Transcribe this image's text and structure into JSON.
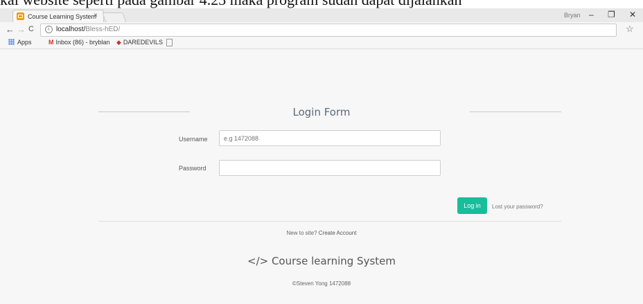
{
  "doc_caption": "kai website seperti pada gambar 4.23 maka program sudah dapat dijalankan",
  "browser": {
    "tab_title": "Course Learning System",
    "tab_close": "×",
    "user_label": "Bryan",
    "win_minimize": "–",
    "win_restore": "❐",
    "win_close": "✕",
    "back": "←",
    "forward": "→",
    "reload": "C",
    "url_host": "localhost/",
    "url_path": "Bless-hED/",
    "star": "☆",
    "bookmarks": {
      "apps": "Apps",
      "gmail": "Inbox (86) - bryblan",
      "daredevils": "DAREDEVILS"
    }
  },
  "page": {
    "form_title": "Login Form",
    "username_label": "Username",
    "username_placeholder": "e.g 1472088",
    "password_label": "Password",
    "login_button": "Log in",
    "lost_password": "Lost your password?",
    "new_to_site": "New to site? ",
    "create_account": "Create Account",
    "brand": "</> Course learning System",
    "copyright": "©Steven Yong 1472088"
  },
  "colors": {
    "accent": "#1abc9c",
    "page_bg": "#f7f7f7"
  }
}
